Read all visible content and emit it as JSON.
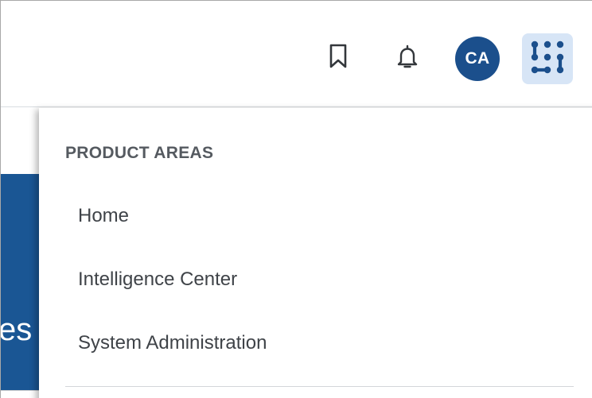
{
  "header": {
    "icons": {
      "bookmark": "bookmark-icon",
      "notifications": "bell-icon",
      "apps": "apps-grid-icon"
    },
    "avatar_initials": "CA"
  },
  "background": {
    "partial_text": "es"
  },
  "product_menu": {
    "heading": "PRODUCT AREAS",
    "items": [
      {
        "label": "Home"
      },
      {
        "label": "Intelligence Center"
      },
      {
        "label": "System Administration"
      }
    ]
  },
  "colors": {
    "avatar_bg": "#1b4f8c",
    "apps_button_bg": "#d7e5f6",
    "background_blue": "#1a5694"
  }
}
